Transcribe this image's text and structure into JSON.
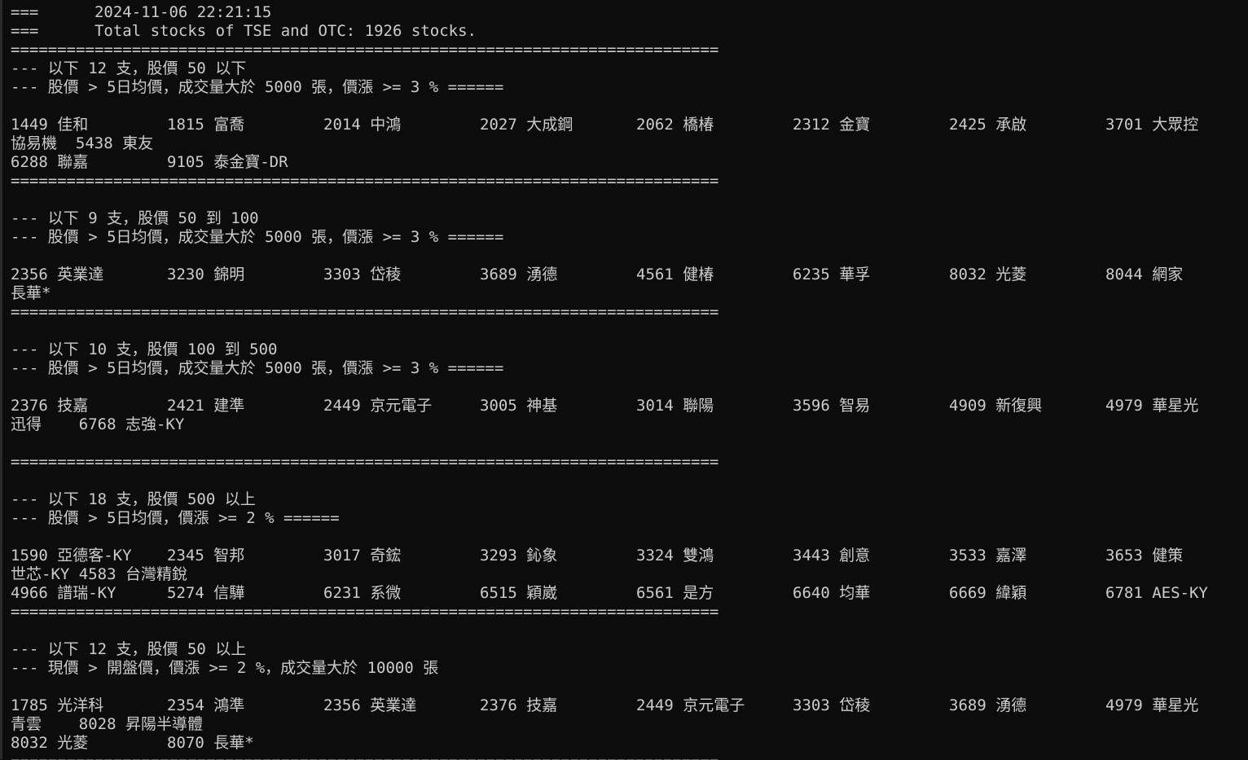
{
  "header": {
    "line1": "===      2024-11-06 22:21:15",
    "line2": "===      Total stocks of TSE and OTC: 1926 stocks."
  },
  "separator": "============================================================================",
  "sections": [
    {
      "title": "--- 以下 12 支，股價 50 以下",
      "condition": "--- 股價 > 5日均價，成交量大於 5000 張，價漲 >= 3 % ======",
      "row1": [
        "1449 佳和",
        "1815 富喬",
        "2014 中鴻",
        "2027 大成鋼",
        "2062 橋椿",
        "2312 金寶",
        "2425 承啟",
        "3701 大眾控"
      ],
      "wrap": "協易機  5438 東友",
      "row2": [
        "6288 聯嘉",
        "9105 泰金寶-DR"
      ]
    },
    {
      "title": "--- 以下 9 支，股價 50 到 100",
      "condition": "--- 股價 > 5日均價，成交量大於 5000 張，價漲 >= 3 % ======",
      "row1": [
        "2356 英業達",
        "3230 錦明",
        "3303 岱稜",
        "3689 湧德",
        "4561 健椿",
        "6235 華孚",
        "8032 光菱",
        "8044 網家"
      ],
      "wrap": "長華*"
    },
    {
      "title": "--- 以下 10 支，股價 100 到 500",
      "condition": "--- 股價 > 5日均價，成交量大於 5000 張，價漲 >= 3 % ======",
      "row1": [
        "2376 技嘉",
        "2421 建準",
        "2449 京元電子",
        "3005 神基",
        "3014 聯陽",
        "3596 智易",
        "4909 新復興",
        "4979 華星光"
      ],
      "wrap": "迅得    6768 志強-KY"
    },
    {
      "title": "--- 以下 18 支，股價 500 以上",
      "condition": "--- 股價 > 5日均價，價漲 >= 2 % ======",
      "row1": [
        "1590 亞德客-KY",
        "2345 智邦",
        "3017 奇鋐",
        "3293 鈊象",
        "3324 雙鴻",
        "3443 創意",
        "3533 嘉澤",
        "3653 健策"
      ],
      "wrap": "世芯-KY 4583 台灣精銳",
      "row2": [
        "4966 譜瑞-KY",
        "5274 信驊",
        "6231 系微",
        "6515 穎崴",
        "6561 是方",
        "6640 均華",
        "6669 緯穎",
        "6781 AES-KY"
      ]
    },
    {
      "title": "--- 以下 12 支，股價 50 以上",
      "condition": "--- 現價 > 開盤價，價漲 >= 2 %，成交量大於 10000 張",
      "row1": [
        "1785 光洋科",
        "2354 鴻準",
        "2356 英業達",
        "2376 技嘉",
        "2449 京元電子",
        "3303 岱稜",
        "3689 湧德",
        "4979 華星光"
      ],
      "wrap": "青雲    8028 昇陽半導體",
      "row2": [
        "8032 光菱",
        "8070 長華*"
      ]
    }
  ]
}
